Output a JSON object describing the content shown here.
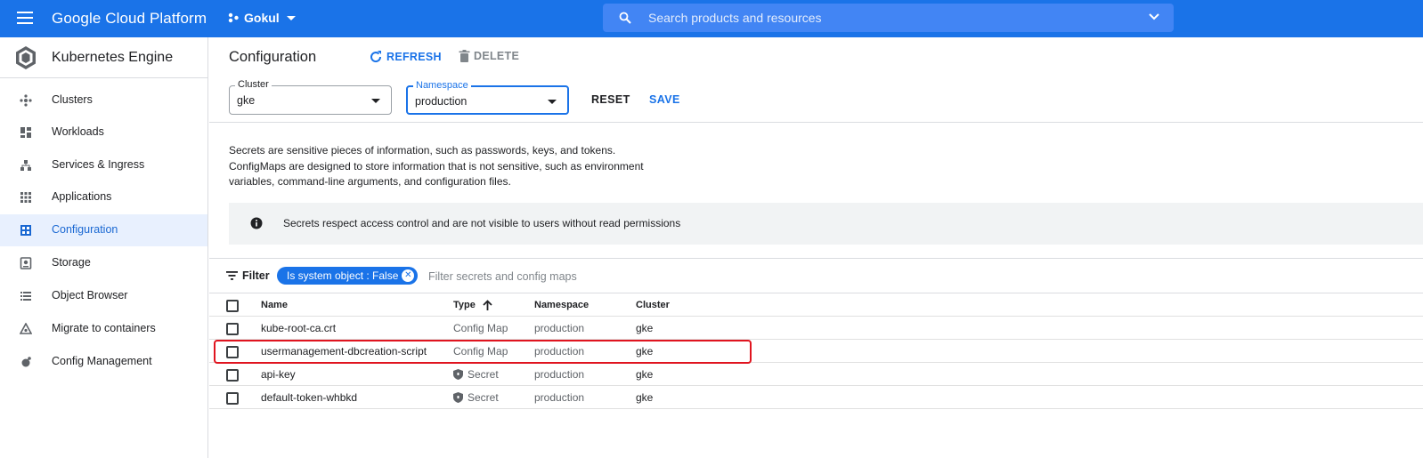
{
  "topbar": {
    "brand": "Google Cloud Platform",
    "project": "Gokul",
    "search_placeholder": "Search products and resources"
  },
  "sidebar": {
    "title": "Kubernetes Engine",
    "items": [
      {
        "label": "Clusters",
        "icon": "clusters-icon"
      },
      {
        "label": "Workloads",
        "icon": "workloads-icon"
      },
      {
        "label": "Services & Ingress",
        "icon": "services-icon"
      },
      {
        "label": "Applications",
        "icon": "applications-icon"
      },
      {
        "label": "Configuration",
        "icon": "configuration-icon",
        "active": true
      },
      {
        "label": "Storage",
        "icon": "storage-icon"
      },
      {
        "label": "Object Browser",
        "icon": "object-browser-icon"
      },
      {
        "label": "Migrate to containers",
        "icon": "migrate-icon"
      },
      {
        "label": "Config Management",
        "icon": "config-management-icon"
      }
    ]
  },
  "main": {
    "title": "Configuration",
    "refresh_label": "REFRESH",
    "delete_label": "DELETE",
    "cluster": {
      "label": "Cluster",
      "value": "gke"
    },
    "namespace": {
      "label": "Namespace",
      "value": "production"
    },
    "reset_label": "RESET",
    "save_label": "SAVE",
    "description": [
      "Secrets are sensitive pieces of information, such as passwords, keys, and tokens.",
      "ConfigMaps are designed to store information that is not sensitive, such as environment",
      "variables, command-line arguments, and configuration files."
    ],
    "banner": "Secrets respect access control and are not visible to users without read permissions",
    "filter": {
      "label": "Filter",
      "chip": "Is system object : False",
      "placeholder": "Filter secrets and config maps"
    },
    "table": {
      "headers": {
        "name": "Name",
        "type": "Type",
        "namespace": "Namespace",
        "cluster": "Cluster"
      },
      "rows": [
        {
          "name": "kube-root-ca.crt",
          "type": "Config Map",
          "namespace": "production",
          "cluster": "gke"
        },
        {
          "name": "usermanagement-dbcreation-script",
          "type": "Config Map",
          "namespace": "production",
          "cluster": "gke"
        },
        {
          "name": "api-key",
          "type": "Secret",
          "namespace": "production",
          "cluster": "gke"
        },
        {
          "name": "default-token-whbkd",
          "type": "Secret",
          "namespace": "production",
          "cluster": "gke"
        }
      ]
    }
  },
  "colors": {
    "primary": "#1a73e8",
    "highlight": "#e0141f",
    "active_bg": "#e8f0fe"
  }
}
